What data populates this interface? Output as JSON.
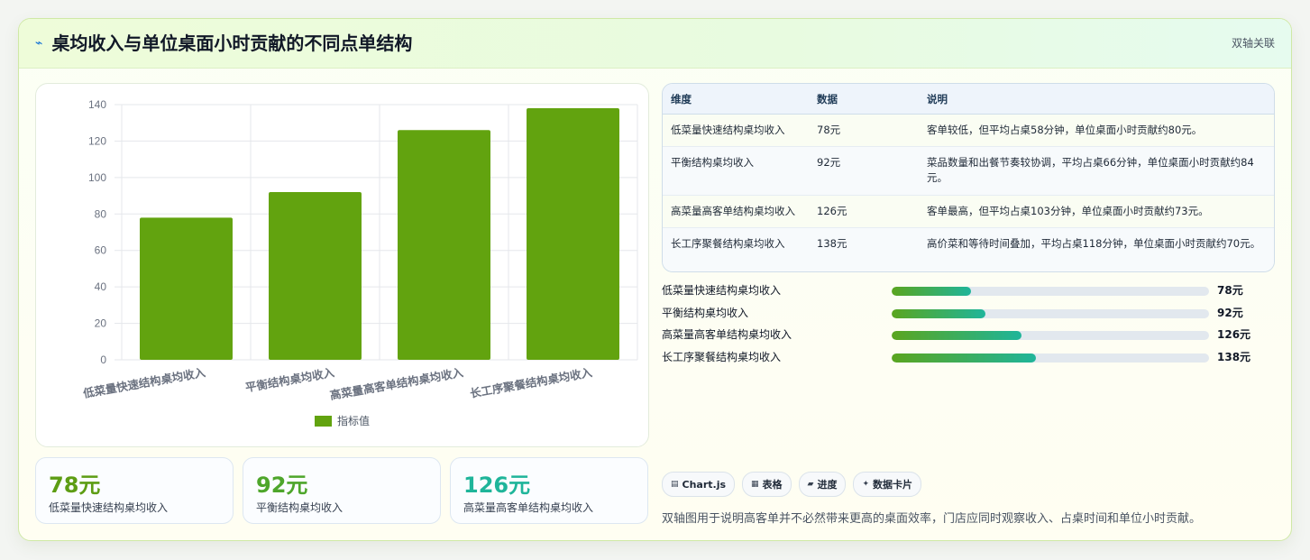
{
  "header": {
    "icon": "line-chart-icon",
    "title": "桌均收入与单位桌面小时贡献的不同点单结构",
    "right_label": "双轴关联"
  },
  "chart_data": {
    "type": "bar",
    "categories": [
      "低菜量快速结构桌均收入",
      "平衡结构桌均收入",
      "高菜量高客单结构桌均收入",
      "长工序聚餐结构桌均收入"
    ],
    "series": [
      {
        "name": "指标值",
        "values": [
          78,
          92,
          126,
          138
        ],
        "color": "#62a30f"
      }
    ],
    "ylim": [
      0,
      140
    ],
    "yticks": [
      0,
      20,
      40,
      60,
      80,
      100,
      120,
      140
    ],
    "ytick_labels": [
      "0",
      "20",
      "40",
      "60",
      "80",
      "100",
      "120",
      "140"
    ],
    "legend_position": "bottom",
    "grid": true
  },
  "kpis": [
    {
      "value": "78元",
      "label": "低菜量快速结构桌均收入",
      "color": "#5d9d14"
    },
    {
      "value": "92元",
      "label": "平衡结构桌均收入",
      "color": "#4ea62b"
    },
    {
      "value": "126元",
      "label": "高菜量高客单结构桌均收入",
      "color": "#1fb59a"
    }
  ],
  "table": {
    "headers": [
      "维度",
      "数据",
      "说明"
    ],
    "rows": [
      [
        "低菜量快速结构桌均收入",
        "78元",
        "客单较低，但平均占桌58分钟，单位桌面小时贡献约80元。"
      ],
      [
        "平衡结构桌均收入",
        "92元",
        "菜品数量和出餐节奏较协调，平均占桌66分钟，单位桌面小时贡献约84元。"
      ],
      [
        "高菜量高客单结构桌均收入",
        "126元",
        "客单最高，但平均占桌103分钟，单位桌面小时贡献约73元。"
      ],
      [
        "长工序聚餐结构桌均收入",
        "138元",
        "高价菜和等待时间叠加，平均占桌118分钟，单位桌面小时贡献约70元。"
      ]
    ]
  },
  "progress": [
    {
      "label": "低菜量快速结构桌均收入",
      "value": "78元",
      "fraction": 0.25
    },
    {
      "label": "平衡结构桌均收入",
      "value": "92元",
      "fraction": 0.295
    },
    {
      "label": "高菜量高客单结构桌均收入",
      "value": "126元",
      "fraction": 0.41
    },
    {
      "label": "长工序聚餐结构桌均收入",
      "value": "138元",
      "fraction": 0.455
    }
  ],
  "chips": [
    {
      "icon": "chart-icon",
      "glyph": "▤",
      "label": "Chart.js"
    },
    {
      "icon": "table-icon",
      "glyph": "▦",
      "label": "表格"
    },
    {
      "icon": "progress-icon",
      "glyph": "▰",
      "label": "进度"
    },
    {
      "icon": "sparkle-icon",
      "glyph": "✦",
      "label": "数据卡片"
    }
  ],
  "footnote": "双轴图用于说明高客单并不必然带来更高的桌面效率，门店应同时观察收入、占桌时间和单位小时贡献。"
}
